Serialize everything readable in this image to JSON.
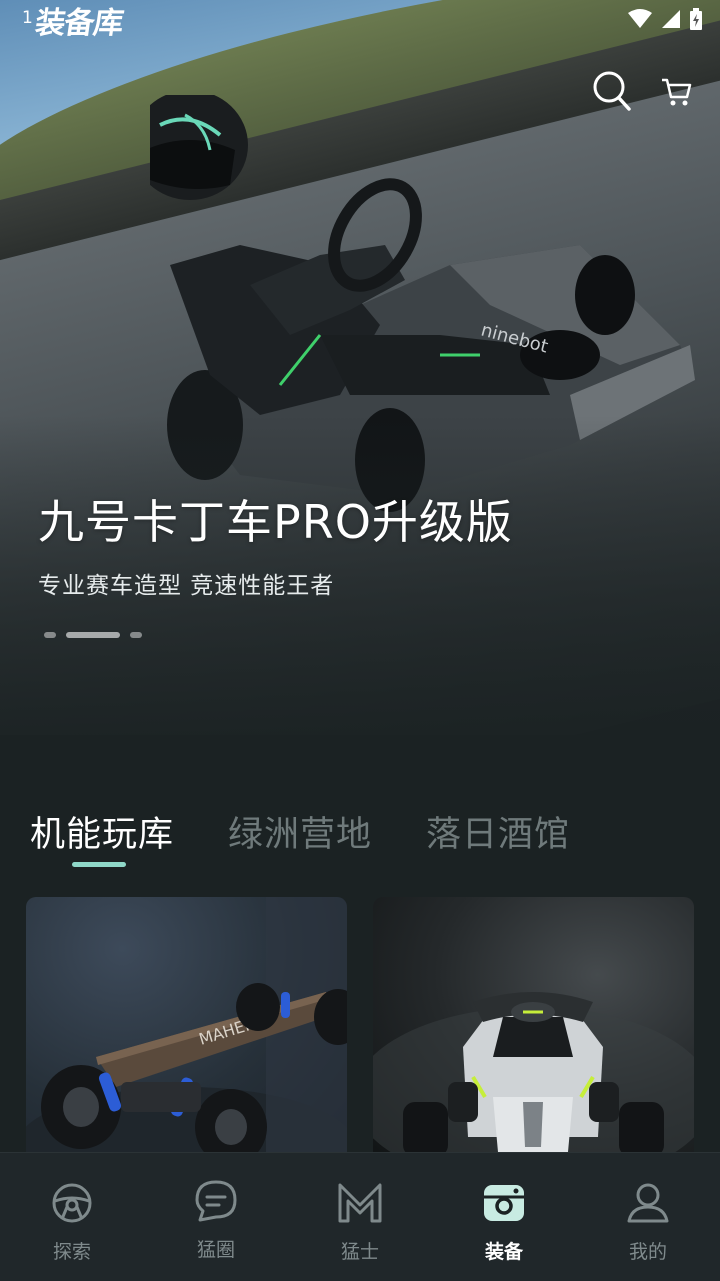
{
  "status_bar": {
    "time": "1",
    "app_name": "装备库"
  },
  "hero": {
    "title": "九号卡丁车PRO升级版",
    "subtitle": "专业赛车造型 竞速性能王者",
    "carousel_pages": 3,
    "carousel_active": 2
  },
  "tabs": [
    {
      "label": "机能玩库",
      "active": true
    },
    {
      "label": "绿洲营地",
      "active": false
    },
    {
      "label": "落日酒馆",
      "active": false
    }
  ],
  "cards": [
    {
      "image": "electric-skateboard"
    },
    {
      "image": "go-kart"
    }
  ],
  "nav": {
    "items": [
      {
        "label": "探索",
        "icon": "steering-wheel-icon",
        "active": false
      },
      {
        "label": "猛圈",
        "icon": "chat-bubble-icon",
        "active": false
      },
      {
        "label": "猛士",
        "icon": "m-logo-icon",
        "active": false
      },
      {
        "label": "装备",
        "icon": "camera-box-icon",
        "active": true
      },
      {
        "label": "我的",
        "icon": "user-icon",
        "active": false
      }
    ]
  },
  "colors": {
    "background": "#1b2223",
    "accent": "#8fd8c8",
    "nav_bg": "#20272a",
    "inactive": "#7f8a8c"
  }
}
